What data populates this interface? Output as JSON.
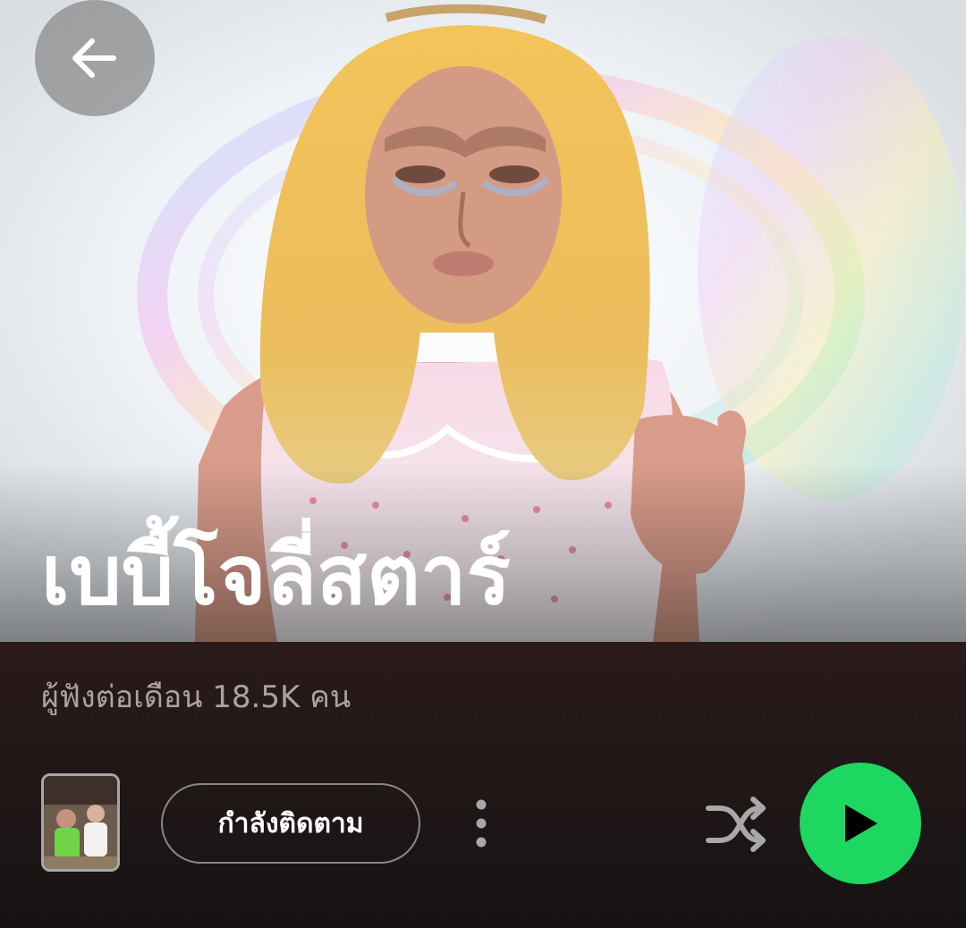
{
  "artist": {
    "name": "เบบี้โจลี่สตาร์",
    "monthly_listeners": "ผู้ฟังต่อเดือน 18.5K คน"
  },
  "actions": {
    "follow_label": "กำลังติดตาม"
  },
  "icons": {
    "back": "arrow-left-icon",
    "more": "vertical-dots-icon",
    "shuffle": "shuffle-icon",
    "play": "play-icon"
  },
  "colors": {
    "accent": "#1ed760",
    "panel_bg": "#231818",
    "secondary_text": "#a9a3a3"
  }
}
